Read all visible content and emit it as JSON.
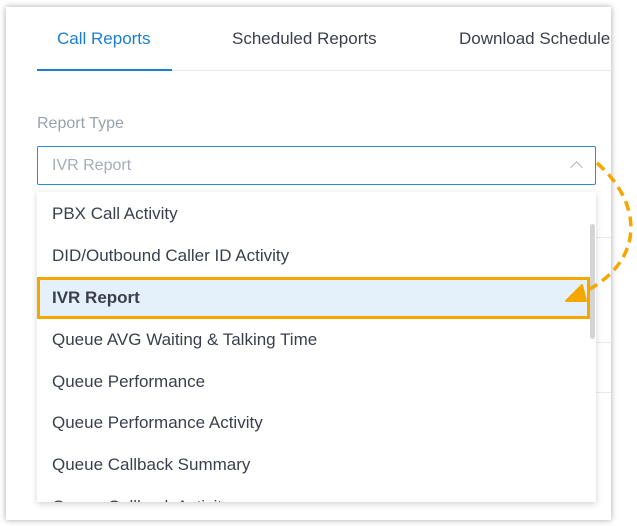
{
  "tabs": [
    {
      "label": "Call Reports",
      "active": true
    },
    {
      "label": "Scheduled Reports"
    },
    {
      "label": "Download Schedule"
    }
  ],
  "report_type": {
    "label": "Report Type",
    "value": "IVR Report"
  },
  "options": [
    "PBX Call Activity",
    "DID/Outbound Caller ID Activity",
    "IVR Report",
    "Queue AVG Waiting & Talking Time",
    "Queue Performance",
    "Queue Performance Activity",
    "Queue Callback Summary",
    "Queue Callback Activity"
  ],
  "selected_index": 2,
  "colors": {
    "accent": "#1a7fd0",
    "highlight": "#f5a700",
    "selected_bg": "#e5f1fa"
  }
}
